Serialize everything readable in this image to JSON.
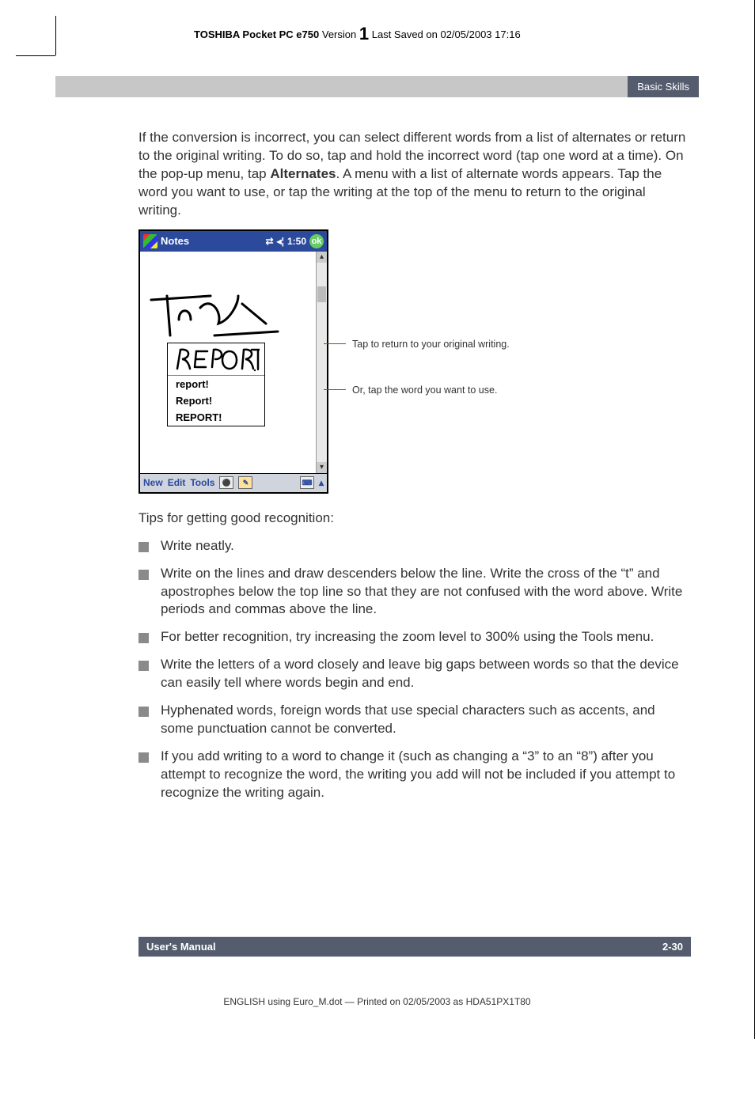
{
  "header": {
    "product": "TOSHIBA Pocket PC e750",
    "version_label": "Version",
    "version_num": "1",
    "saved": "Last Saved on 02/05/2003 17:16"
  },
  "chapter": "Basic Skills",
  "para1": {
    "pre": "If the conversion is incorrect, you can select different words from a list of alternates or return to the original writing. To do so, tap and hold the incorrect word (tap one word at a time). On the pop-up menu, tap ",
    "bold": "Alternates",
    "post": ". A menu with a list of alternate words appears. Tap the word you want to use, or tap the writing at the top of the menu to return to the original writing."
  },
  "device": {
    "title": "Notes",
    "time": "1:50",
    "ok": "ok",
    "menu_items": [
      "report!",
      "Report!",
      "REPORT!"
    ],
    "footer": {
      "new": "New",
      "edit": "Edit",
      "tools": "Tools"
    }
  },
  "callouts": {
    "c1": "Tap to return to your original writing.",
    "c2": "Or, tap the word you want to use."
  },
  "tips_intro": "Tips for getting good recognition:",
  "tips": [
    {
      "text": "Write neatly."
    },
    {
      "text": "Write on the lines and draw descenders below the line. Write the cross of the “t” and apostrophes below the top line so that they are not confused with the word above. Write periods and commas above the line."
    },
    {
      "pre": "For better recognition, try increasing the zoom level to 300% using the ",
      "bold": "Tools",
      "post": " menu."
    },
    {
      "text": "Write the letters of a word closely and leave big gaps between words so that the device can easily tell where words begin and end."
    },
    {
      "text": "Hyphenated words, foreign words that use special characters such as accents, and some punctuation cannot be converted."
    },
    {
      "text": "If you add writing to a word to change it (such as changing a “3” to an “8”) after you attempt to recognize the word, the writing you add will not be included if you attempt to recognize the writing again."
    }
  ],
  "footer": {
    "left": "User's Manual",
    "right": "2-30"
  },
  "print_footer": "ENGLISH using Euro_M.dot — Printed on 02/05/2003 as HDA51PX1T80",
  "icons": {
    "conn": "⇄",
    "vol": "◂¦",
    "kbd": "⌨",
    "up": "▴",
    "down": "▾",
    "rec": "⚫"
  }
}
